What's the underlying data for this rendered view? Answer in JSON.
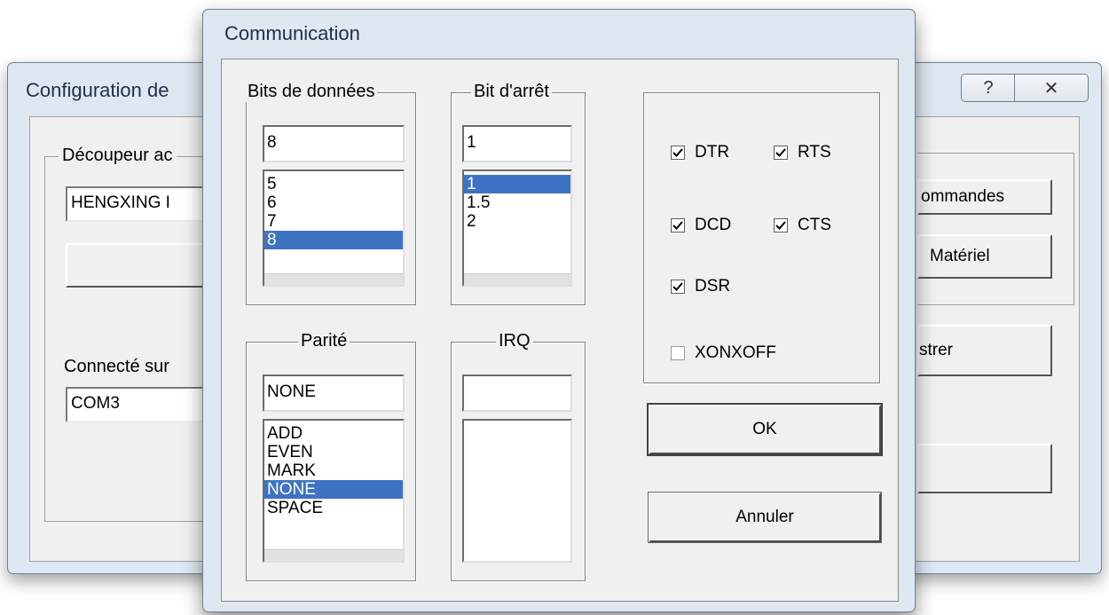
{
  "bg_window": {
    "title": "Configuration de",
    "help_icon": "?",
    "close_icon": "✕",
    "group_label": "Découpeur ac",
    "device_name_value": "HENGXING I",
    "connected_label": "Connecté sur",
    "port_value": "COM3",
    "commands_button": "ommandes",
    "hardware_button": "Matériel",
    "register_button": "strer"
  },
  "dialog": {
    "title": "Communication",
    "data_bits": {
      "label": "Bits de données",
      "value": "8",
      "options": [
        "5",
        "6",
        "7",
        "8"
      ],
      "selected": "8"
    },
    "stop_bit": {
      "label": "Bit d'arrêt",
      "value": "1",
      "options": [
        "1",
        "1.5",
        "2"
      ],
      "selected": "1"
    },
    "parity": {
      "label": "Parité",
      "value": "NONE",
      "options": [
        "ADD",
        "EVEN",
        "MARK",
        "NONE",
        "SPACE"
      ],
      "selected": "NONE"
    },
    "irq": {
      "label": "IRQ",
      "value": "",
      "options": []
    },
    "flags": {
      "dtr": {
        "label": "DTR",
        "checked": true
      },
      "rts": {
        "label": "RTS",
        "checked": true
      },
      "dcd": {
        "label": "DCD",
        "checked": true
      },
      "cts": {
        "label": "CTS",
        "checked": true
      },
      "dsr": {
        "label": "DSR",
        "checked": true
      },
      "xonxoff": {
        "label": "XONXOFF",
        "checked": false
      }
    },
    "ok_label": "OK",
    "cancel_label": "Annuler"
  },
  "colors": {
    "selection": "#3e73c3",
    "frame": "#dfe8f2"
  }
}
